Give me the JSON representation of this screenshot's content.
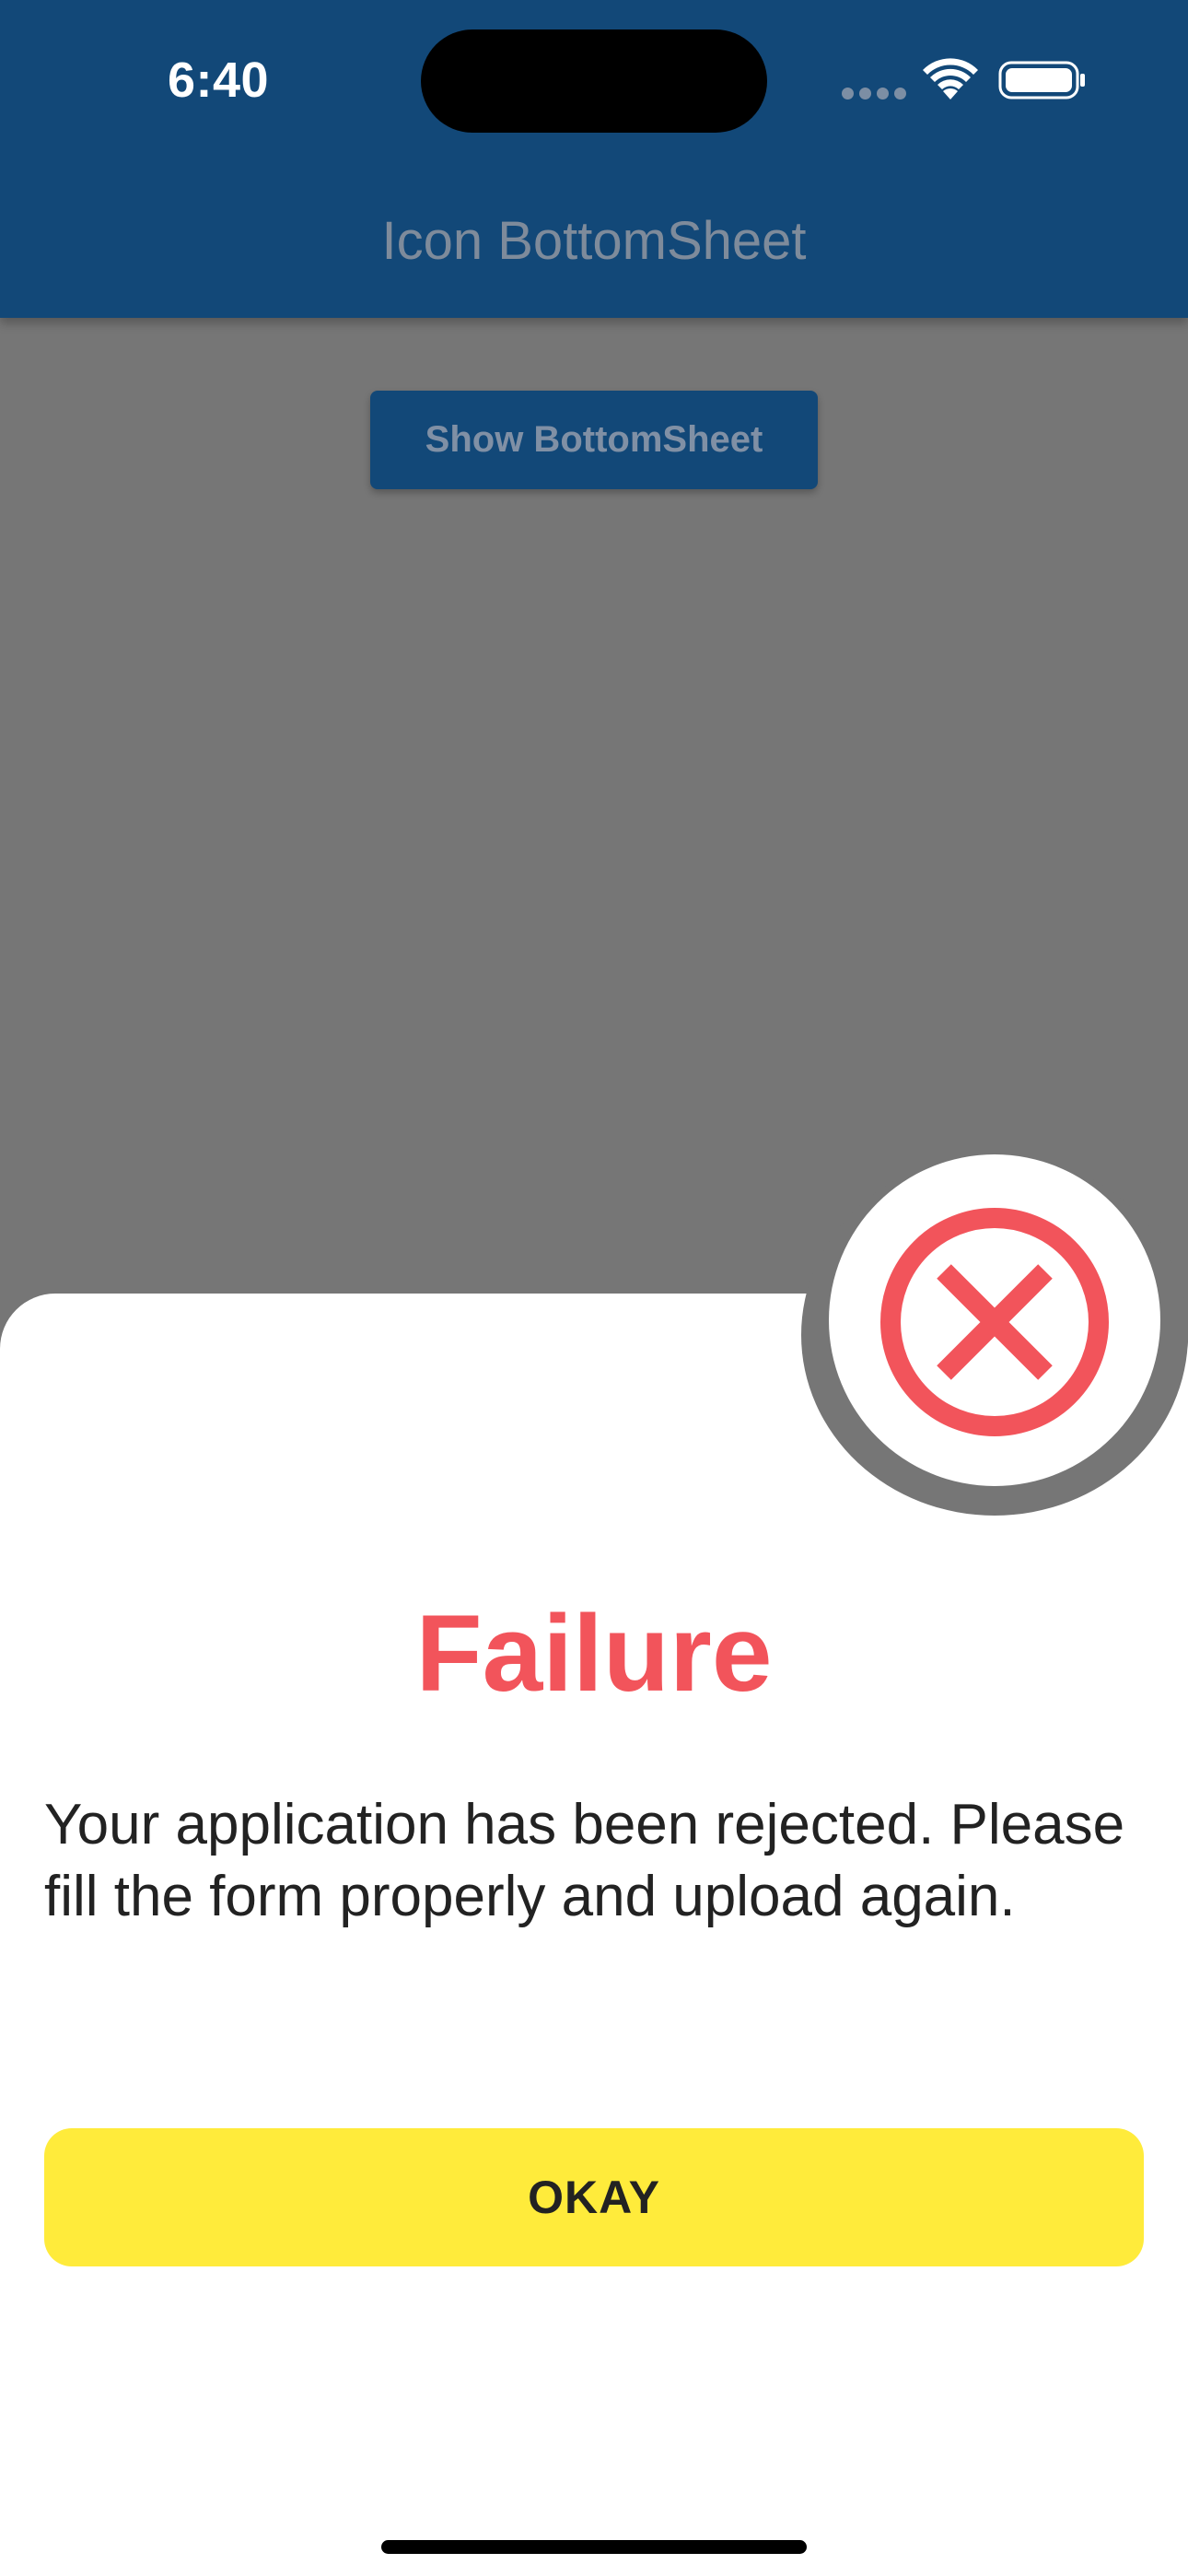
{
  "status_bar": {
    "time": "6:40",
    "signal_icon": "signal-dots-icon",
    "wifi_icon": "wifi-icon",
    "battery_icon": "battery-icon"
  },
  "app_bar": {
    "title": "Icon BottomSheet"
  },
  "main": {
    "show_button_label": "Show BottomSheet"
  },
  "bottom_sheet": {
    "icon": "close-circle-icon",
    "title": "Failure",
    "message": "Your application has been rejected. Please fill the form properly and upload again.",
    "button_label": "OKAY"
  },
  "colors": {
    "app_bar": "#124878",
    "scrim": "#767676",
    "failure_red": "#f2545b",
    "okay_button": "#ffeb3b"
  }
}
